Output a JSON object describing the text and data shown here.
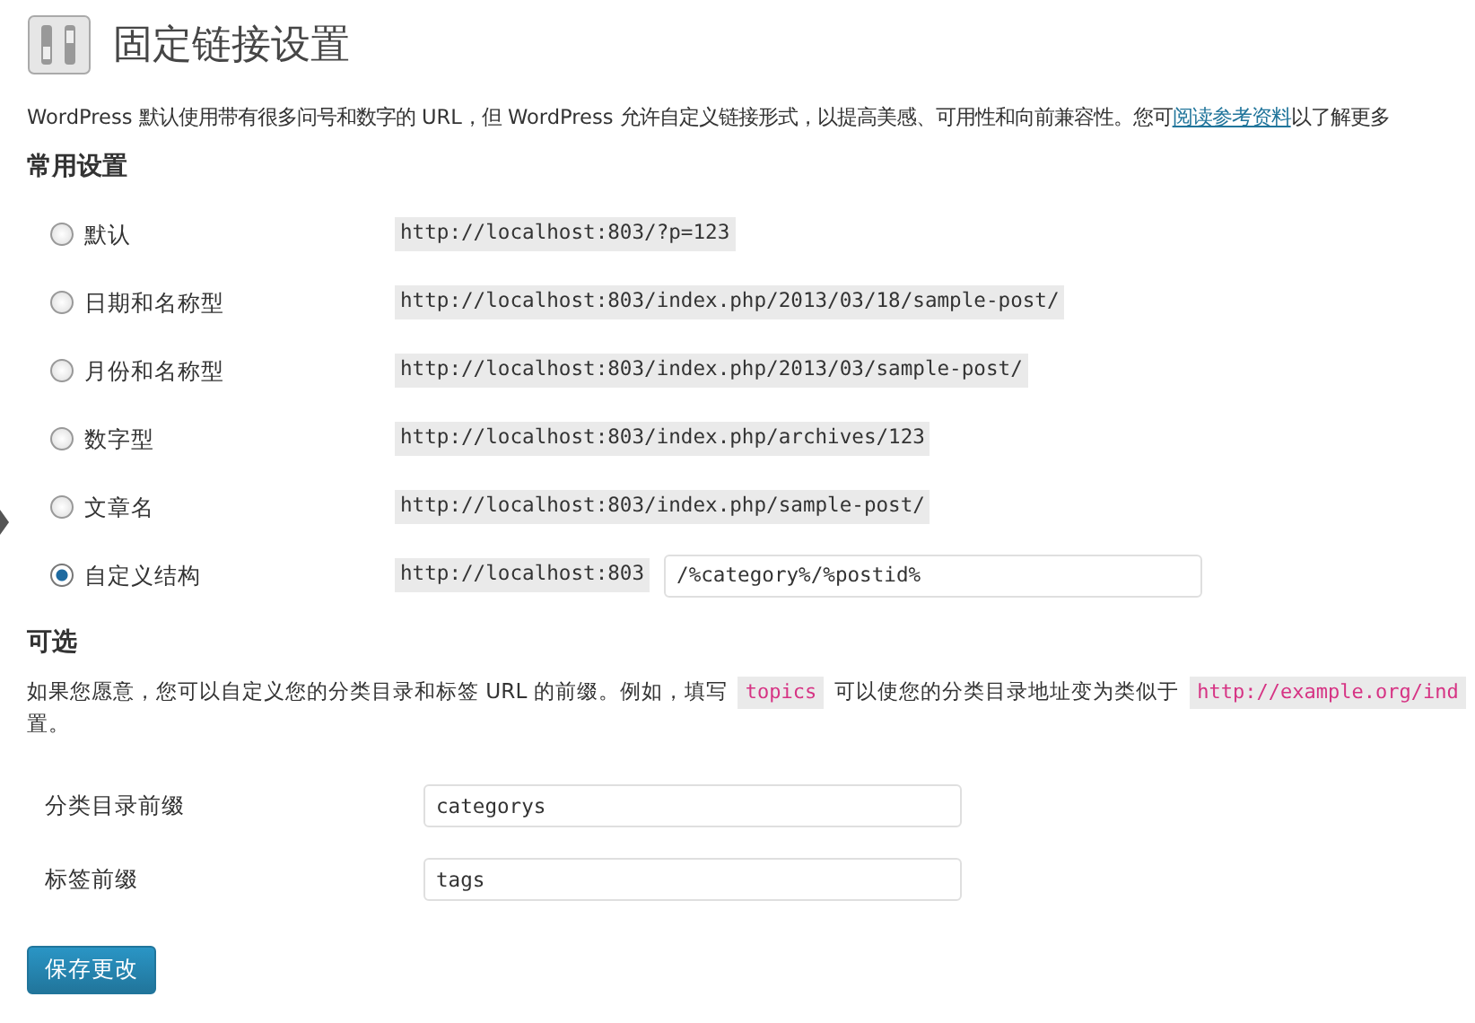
{
  "page": {
    "title": "固定链接设置"
  },
  "intro": [
    {
      "kind": "text",
      "text": "WordPress 默认使用带有很多问号和数字的 URL，但 WordPress 允许自定义链接形式，以提高美感、可用性和向前兼容性。您可"
    },
    {
      "kind": "link",
      "text": "阅读参考资料"
    },
    {
      "kind": "text",
      "text": "以了解更多"
    }
  ],
  "common_settings": {
    "heading": "常用设置",
    "options": [
      {
        "label": "默认",
        "selected": false,
        "example": "http://localhost:803/?p=123"
      },
      {
        "label": "日期和名称型",
        "selected": false,
        "example": "http://localhost:803/index.php/2013/03/18/sample-post/"
      },
      {
        "label": "月份和名称型",
        "selected": false,
        "example": "http://localhost:803/index.php/2013/03/sample-post/"
      },
      {
        "label": "数字型",
        "selected": false,
        "example": "http://localhost:803/index.php/archives/123"
      },
      {
        "label": "文章名",
        "selected": false,
        "example": "http://localhost:803/index.php/sample-post/"
      },
      {
        "label": "自定义结构",
        "selected": true,
        "example": "http://localhost:803",
        "value": "/%category%/%postid%"
      }
    ]
  },
  "optional": {
    "heading": "可选",
    "description_lines": [
      [
        {
          "kind": "text",
          "text": "如果您愿意，您可以自定义您的分类目录和标签 URL 的前缀。例如，填写"
        },
        {
          "kind": "code",
          "text": "topics"
        },
        {
          "kind": "text",
          "text": "可以使您的分类目录地址变为类似于"
        },
        {
          "kind": "code",
          "text": "http://example.org/ind"
        }
      ],
      [
        {
          "kind": "text",
          "text": "置。"
        }
      ]
    ],
    "fields": [
      {
        "label": "分类目录前缀",
        "value": "categorys"
      },
      {
        "label": "标签前缀",
        "value": "tags"
      }
    ]
  },
  "save_button": "保存更改"
}
